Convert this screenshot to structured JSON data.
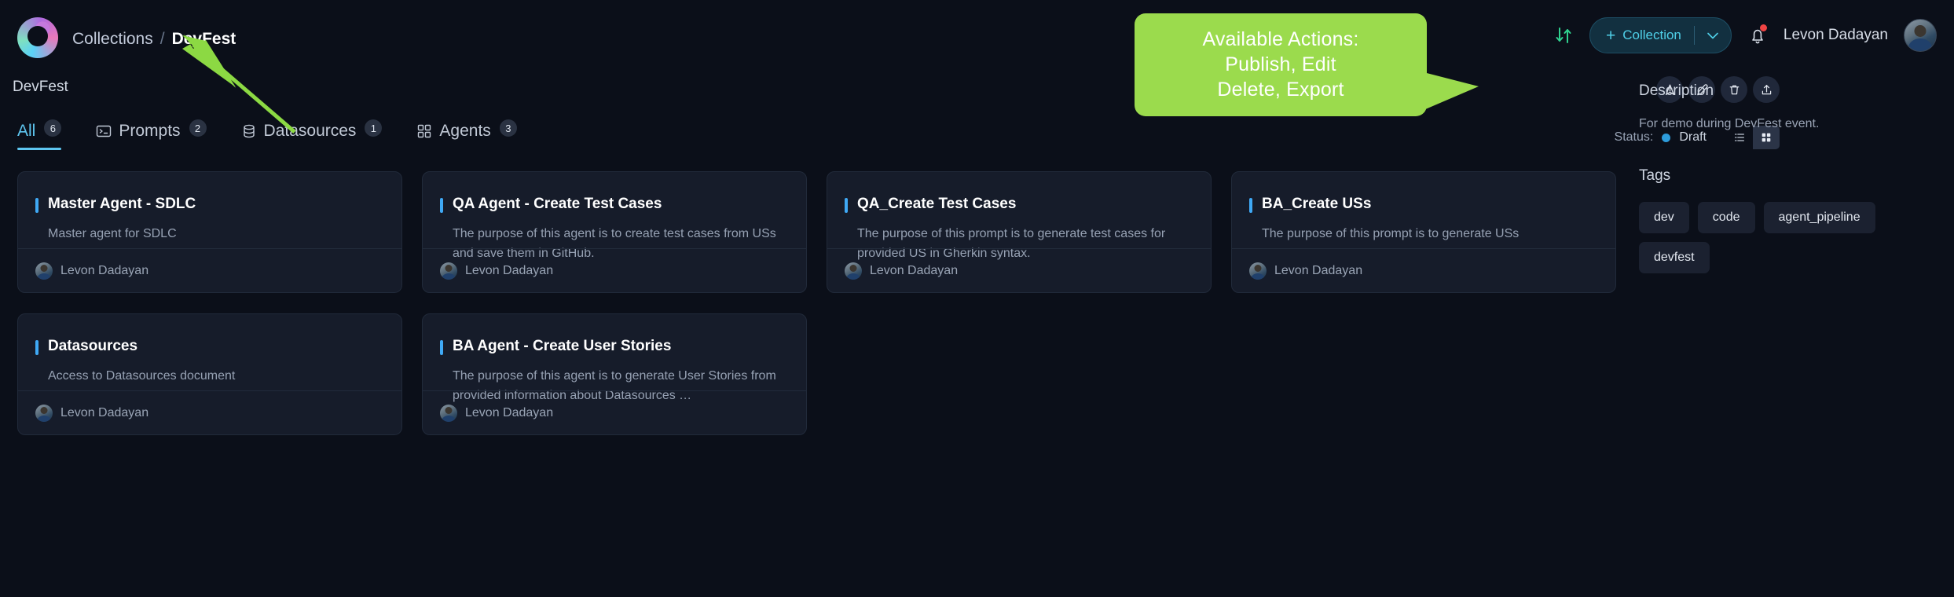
{
  "breadcrumb": {
    "root": "Collections",
    "separator": "/",
    "current": "DevFest"
  },
  "collection_title": "DevFest",
  "tabs": [
    {
      "label": "All",
      "count": "6",
      "icon": "none",
      "active": true
    },
    {
      "label": "Prompts",
      "count": "2",
      "icon": "terminal-icon",
      "active": false
    },
    {
      "label": "Datasources",
      "count": "1",
      "icon": "database-icon",
      "active": false
    },
    {
      "label": "Agents",
      "count": "3",
      "icon": "grid-icon",
      "active": false
    }
  ],
  "header": {
    "sort_icon": "sort-icon",
    "collection_button": {
      "plus": "+",
      "label": "Collection",
      "caret": "⌄"
    },
    "bell_icon": "notification-bell-icon",
    "user_name": "Levon Dadayan",
    "avatar": "user-avatar"
  },
  "actions": [
    {
      "name": "publish-button",
      "icon": "publish-icon"
    },
    {
      "name": "edit-button",
      "icon": "pencil-icon"
    },
    {
      "name": "delete-button",
      "icon": "trash-icon"
    },
    {
      "name": "export-button",
      "icon": "export-icon"
    }
  ],
  "status": {
    "label": "Status:",
    "value": "Draft",
    "dot_color": "#2d9cdb"
  },
  "view_toggle": {
    "list": "list-view-icon",
    "grid": "grid-view-icon",
    "active": "grid"
  },
  "callout": {
    "line1": "Available Actions:",
    "line2": "Publish, Edit",
    "line3": "Delete, Export",
    "bg_color": "#9bdb4d"
  },
  "cards": [
    {
      "title": "Master Agent - SDLC",
      "description": "Master agent for SDLC",
      "author": "Levon Dadayan"
    },
    {
      "title": "QA Agent - Create Test Cases",
      "description": "The purpose of this agent is to create test cases from USs and save them in GitHub.",
      "author": "Levon Dadayan"
    },
    {
      "title": "QA_Create Test Cases",
      "description": "The purpose of this prompt is to generate test cases for provided US in Gherkin syntax.",
      "author": "Levon Dadayan"
    },
    {
      "title": "BA_Create USs",
      "description": "The purpose of this prompt is to generate USs",
      "author": "Levon Dadayan"
    },
    {
      "title": "Datasources",
      "description": "Access to Datasources document",
      "author": "Levon Dadayan"
    },
    {
      "title": "BA Agent - Create User Stories",
      "description": "The purpose of this agent is to generate User Stories from provided information about Datasources …",
      "author": "Levon Dadayan"
    }
  ],
  "right_panel": {
    "description_heading": "Description",
    "description_text": "For demo during DevFest event.",
    "tags_heading": "Tags",
    "tags": [
      "dev",
      "code",
      "agent_pipeline",
      "devfest"
    ]
  },
  "colors": {
    "accent": "#5ec6f0",
    "card_accent": "#3fa9f5",
    "callout": "#9bdb4d",
    "background": "#0b0f19"
  }
}
